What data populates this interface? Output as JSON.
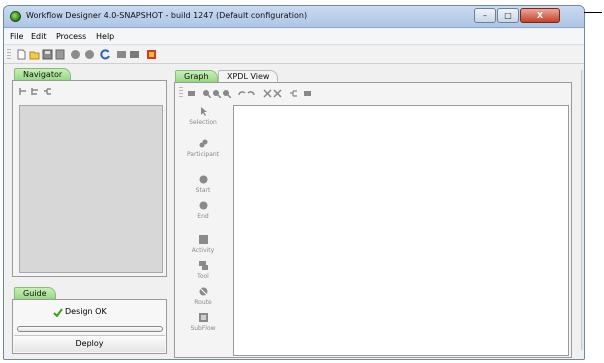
{
  "window": {
    "title": "Workflow Designer 4.0-SNAPSHOT - build 1247 (Default configuration)",
    "controls": {
      "minimize": "–",
      "maximize": "□",
      "close": "X"
    }
  },
  "menu": [
    {
      "label": "File"
    },
    {
      "label": "Edit"
    },
    {
      "label": "Process"
    },
    {
      "label": "Help"
    }
  ],
  "toolbar_icons": [
    "new-document-icon",
    "open-folder-icon",
    "save-icon",
    "save-all-icon",
    "circle-gray-icon",
    "circle-gray-2-icon",
    "refresh-icon",
    "grid-icon",
    "print-icon",
    "palette-icon"
  ],
  "navigator": {
    "tab": "Navigator"
  },
  "guide": {
    "tab": "Guide",
    "status": "Design OK",
    "deploy_label": "Deploy"
  },
  "editor": {
    "tabs": [
      {
        "label": "Graph",
        "active": true
      },
      {
        "label": "XPDL View",
        "active": false
      }
    ]
  },
  "palette": [
    {
      "label": "Selection",
      "icon": "arrow-icon"
    },
    {
      "label": "Participant",
      "icon": "participant-icon"
    },
    {
      "label": "Start",
      "icon": "start-icon"
    },
    {
      "label": "End",
      "icon": "end-icon"
    },
    {
      "label": "Activity",
      "icon": "activity-icon"
    },
    {
      "label": "Tool",
      "icon": "tool-icon"
    },
    {
      "label": "Route",
      "icon": "route-icon"
    },
    {
      "label": "SubFlow",
      "icon": "subflow-icon"
    }
  ],
  "colors": {
    "active_tab": "#92d67c",
    "title_bar": "#adc6e6",
    "close_button": "#c7412a",
    "canvas": "#ffffff"
  }
}
